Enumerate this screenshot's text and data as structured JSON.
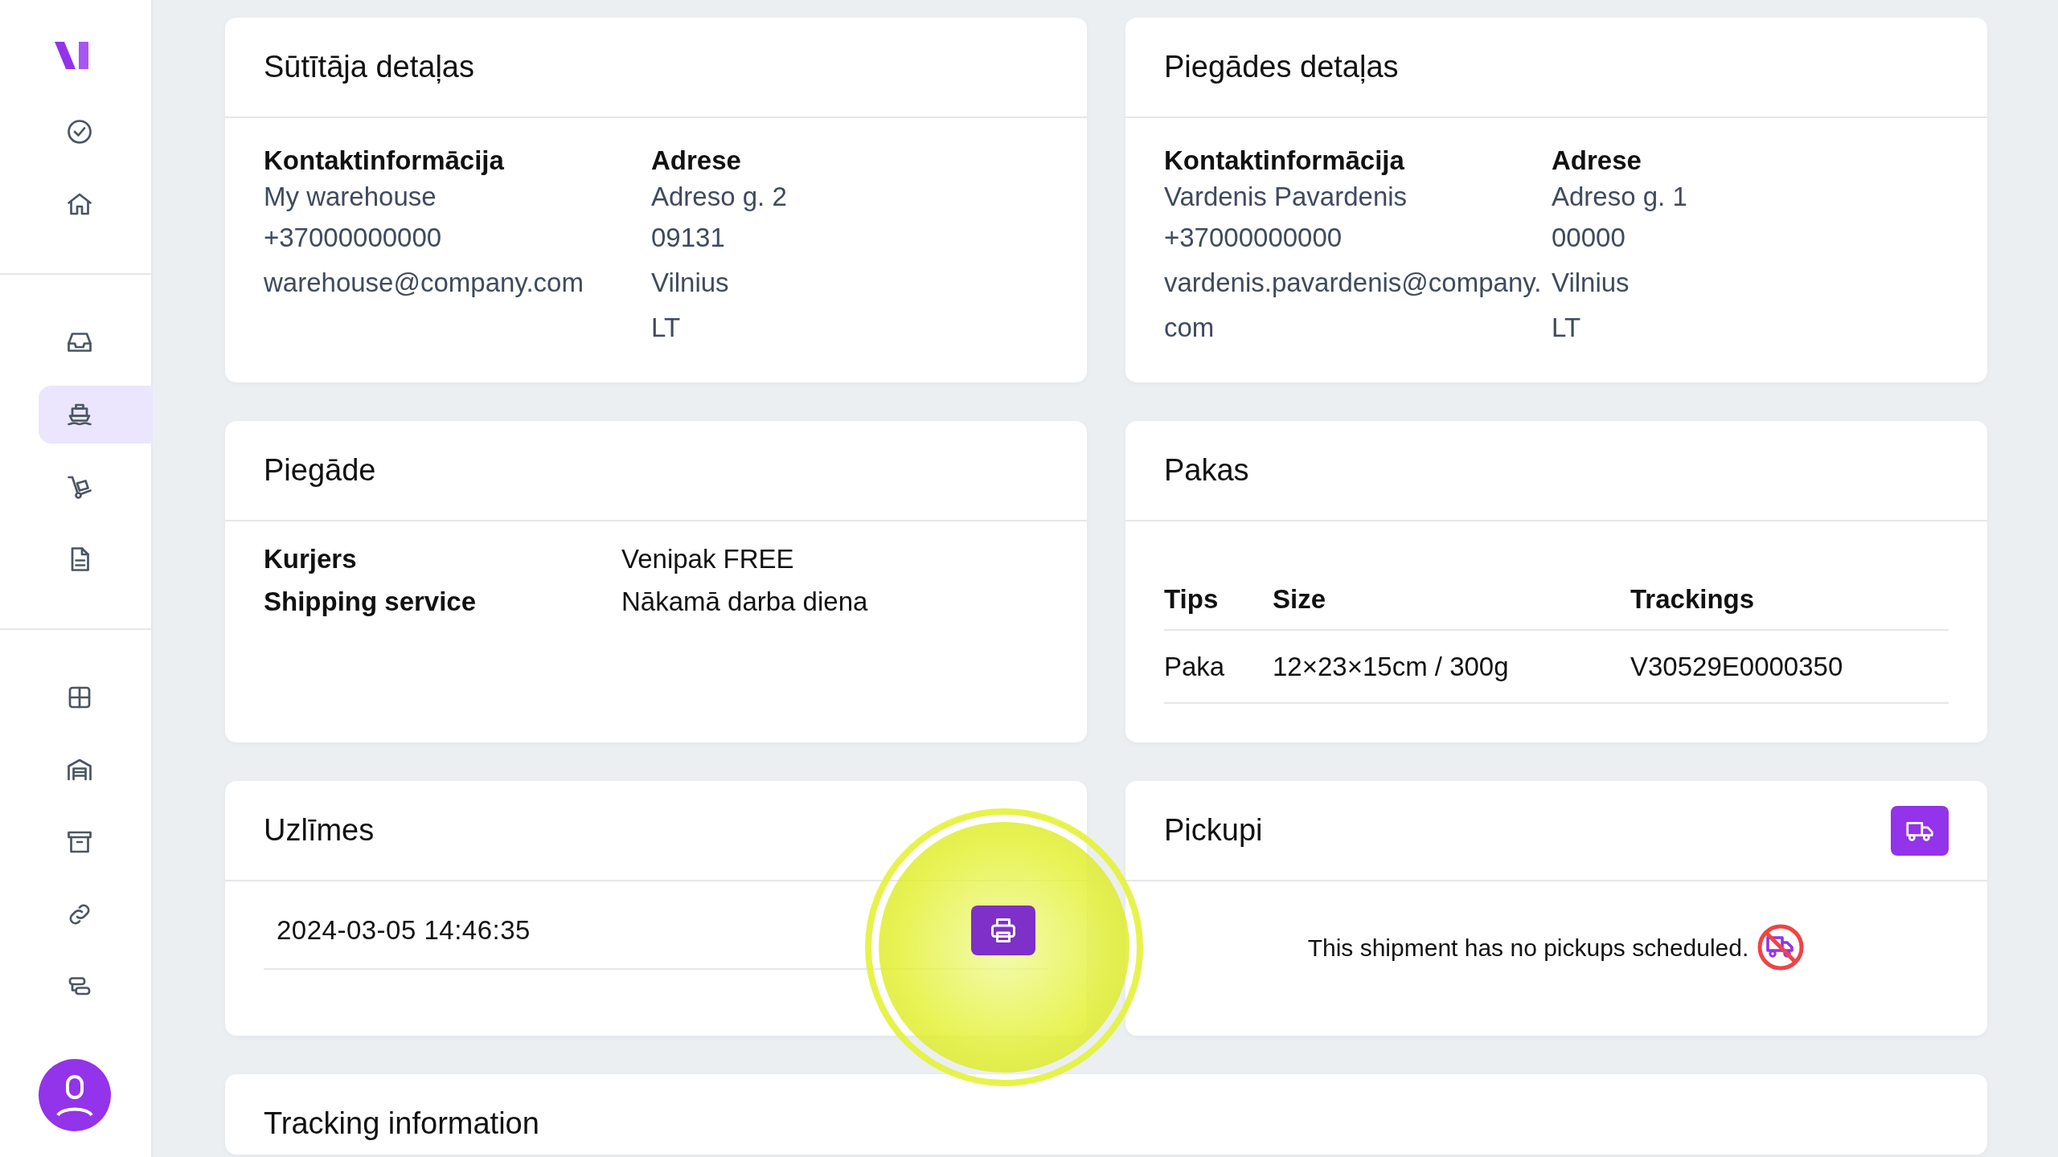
{
  "sidebar": {
    "groups": [
      [
        {
          "selected": false
        },
        {
          "selected": false
        }
      ],
      [
        {
          "selected": false
        },
        {
          "selected": true
        },
        {
          "selected": false
        },
        {
          "selected": false
        }
      ],
      [
        {
          "selected": false
        },
        {
          "selected": false
        },
        {
          "selected": false
        },
        {
          "selected": false
        },
        {
          "selected": false
        }
      ]
    ]
  },
  "sender_details": {
    "title": "Sūtītāja detaļas",
    "contact": {
      "heading": "Kontaktinformācija",
      "lines": [
        "My warehouse",
        "+37000000000",
        "warehouse@company.com"
      ]
    },
    "address": {
      "heading": "Adrese",
      "lines": [
        "Adreso g. 2",
        "09131",
        "Vilnius",
        "LT"
      ]
    }
  },
  "delivery_details": {
    "title": "Piegādes detaļas",
    "contact": {
      "heading": "Kontaktinformācija",
      "lines": [
        "Vardenis Pavardenis",
        "+37000000000",
        "vardenis.pavardenis@company.com"
      ]
    },
    "address": {
      "heading": "Adrese",
      "lines": [
        "Adreso g. 1",
        "00000",
        "Vilnius",
        "LT"
      ]
    }
  },
  "delivery": {
    "title": "Piegāde",
    "rows": [
      {
        "label": "Kurjers",
        "value": "Venipak FREE"
      },
      {
        "label": "Shipping service",
        "value": "Nākamā darba diena"
      }
    ]
  },
  "packages": {
    "title": "Pakas",
    "columns": [
      "Tips",
      "Size",
      "Trackings"
    ],
    "rows": [
      [
        "Paka",
        "12×23×15cm / 300g",
        "V30529E0000350"
      ]
    ]
  },
  "labels": {
    "title": "Uzlīmes",
    "rows": [
      {
        "date": "2024-03-05 14:46:35"
      }
    ]
  },
  "pickups": {
    "title": "Pickupi",
    "message": "This shipment has no pickups scheduled."
  },
  "tracking": {
    "title": "Tracking information"
  }
}
